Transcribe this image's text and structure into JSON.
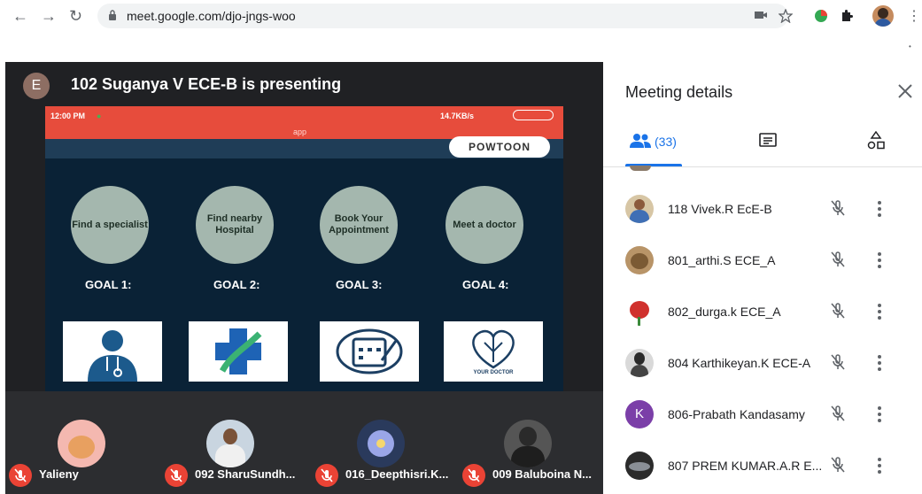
{
  "browser": {
    "url": "meet.google.com/djo-jngs-woo"
  },
  "presentation": {
    "avatar_letter": "E",
    "title": "102 Suganya V ECE-B is presenting",
    "status_time": "12:00 PM",
    "status_right": "14.7KB/s",
    "app_label": "app",
    "powtoon_label": "POWTOON",
    "goals": [
      {
        "circle": "Find a specialist",
        "label": "GOAL 1:"
      },
      {
        "circle": "Find nearby Hospital",
        "label": "GOAL 2:"
      },
      {
        "circle": "Book Your Appointment",
        "label": "GOAL 3:"
      },
      {
        "circle": "Meet a doctor",
        "label": "GOAL 4:"
      }
    ],
    "card4_caption": "YOUR DOCTOR"
  },
  "thumbnails": [
    {
      "name": "Yalieny"
    },
    {
      "name": "092 SharuSundh..."
    },
    {
      "name": "016_Deepthisri.K..."
    },
    {
      "name": "009 Baluboina N..."
    }
  ],
  "panel": {
    "title": "Meeting details",
    "people_count": "(33)",
    "participants": [
      {
        "name": "118 Vivek.R EcE-B"
      },
      {
        "name": "801_arthi.S ECE_A"
      },
      {
        "name": "802_durga.k ECE_A"
      },
      {
        "name": "804 Karthikeyan.K ECE-A"
      },
      {
        "name": "806-Prabath Kandasamy",
        "initial": "K"
      },
      {
        "name": "807 PREM KUMAR.A.R E..."
      }
    ]
  },
  "colors": {
    "accent": "#1a73e8",
    "mute_red": "#ea4335",
    "stage_bg": "#202124",
    "status_bar": "#e74c3c"
  }
}
